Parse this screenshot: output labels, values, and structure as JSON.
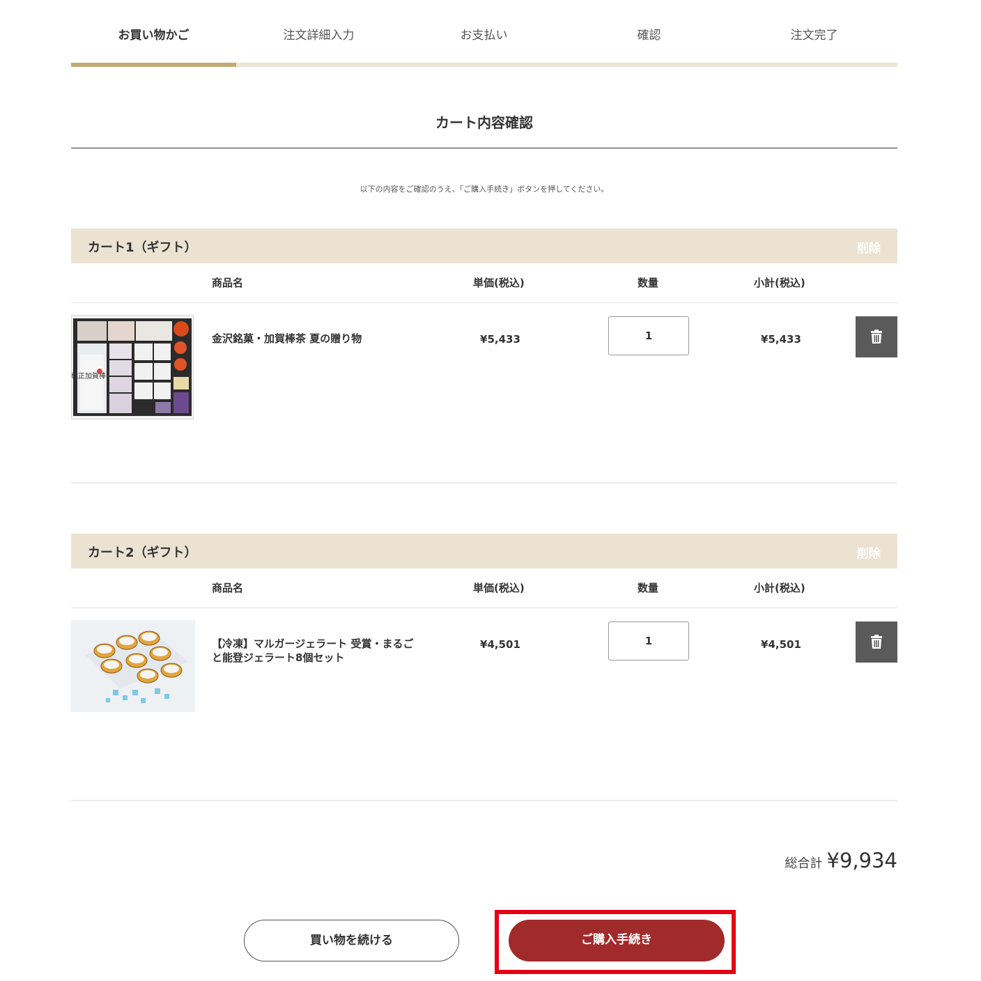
{
  "steps": [
    {
      "label": "お買い物かご",
      "active": true
    },
    {
      "label": "注文詳細入力",
      "active": false
    },
    {
      "label": "お支払い",
      "active": false
    },
    {
      "label": "確認",
      "active": false
    },
    {
      "label": "注文完了",
      "active": false
    }
  ],
  "section_title": "カート内容確認",
  "instruction": "以下の内容をご確認のうえ、「ご購入手続き」ボタンを押してください。",
  "columns": {
    "product": "商品名",
    "unit_price": "単価(税込)",
    "quantity": "数量",
    "subtotal": "小計(税込)"
  },
  "carts": [
    {
      "name": "カート1（ギフト）",
      "delete_label": "削除",
      "item": {
        "name": "金沢銘菓・加賀棒茶 夏の贈り物",
        "price": "¥5,433",
        "quantity": "1",
        "subtotal": "¥5,433",
        "image_icon": "gift-box-photo",
        "image_label": "純正加賀棒茶"
      }
    },
    {
      "name": "カート2（ギフト）",
      "delete_label": "削除",
      "item": {
        "name_line1": "【冷凍】マルガージェラート 受賞・まるご",
        "name_line2": "と能登ジェラート8個セット",
        "price": "¥4,501",
        "quantity": "1",
        "subtotal": "¥4,501",
        "image_icon": "gelato-cups-photo"
      }
    }
  ],
  "total": {
    "label": "総合計",
    "amount": "¥9,934"
  },
  "buttons": {
    "continue": "買い物を続ける",
    "purchase": "ご購入手続き"
  },
  "colors": {
    "step_accent": "#c2ab74",
    "cart_header_bg": "#ebe2d2",
    "purchase_button": "#a12a2a",
    "highlight_border": "#e60012",
    "trash_button": "#5a5a5a"
  }
}
